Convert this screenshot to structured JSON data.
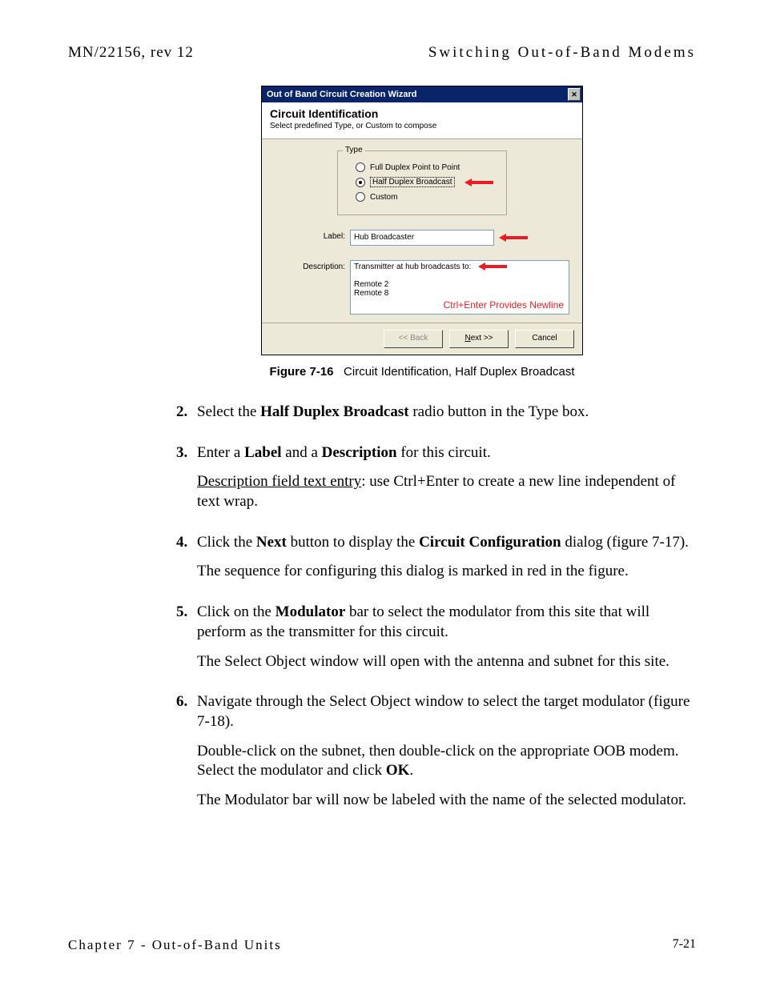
{
  "header": {
    "left": "MN/22156, rev 12",
    "right": "Switching Out-of-Band Modems"
  },
  "dialog": {
    "titlebar": "Out of Band Circuit Creation Wizard",
    "heading": "Circuit Identification",
    "subheading": "Select predefined Type, or Custom to compose",
    "type_legend": "Type",
    "radio_full": "Full Duplex Point to Point",
    "radio_half": "Half Duplex Broadcast",
    "radio_custom": "Custom",
    "label_label": "Label:",
    "label_value": "Hub Broadcaster",
    "desc_label": "Description:",
    "desc_line1": "Transmitter at hub broadcasts to:",
    "desc_line2": "Remote 2",
    "desc_line3": "Remote 8",
    "newline_note": "Ctrl+Enter Provides Newline",
    "btn_back": "<< Back",
    "btn_next_prefix": "N",
    "btn_next_rest": "ext >>",
    "btn_cancel": "Cancel"
  },
  "caption": {
    "fig": "Figure 7-16",
    "text": "Circuit Identification, Half Duplex Broadcast"
  },
  "steps": {
    "s2": {
      "num": "2.",
      "p1a": "Select the ",
      "p1b": "Half Duplex Broadcast",
      "p1c": " radio button in the Type box."
    },
    "s3": {
      "num": "3.",
      "p1a": "Enter a ",
      "p1b": "Label",
      "p1c": " and a ",
      "p1d": "Description",
      "p1e": " for this circuit.",
      "p2a": "Description field text entry",
      "p2b": ": use Ctrl+Enter to create a new line independent of text wrap."
    },
    "s4": {
      "num": "4.",
      "p1a": "Click the ",
      "p1b": "Next",
      "p1c": " button to display the ",
      "p1d": "Circuit Configuration",
      "p1e": " dialog (figure 7-17).",
      "p2": "The sequence for configuring this dialog is marked in red in the figure."
    },
    "s5": {
      "num": "5.",
      "p1a": "Click on the ",
      "p1b": "Modulator",
      "p1c": " bar to select the modulator from this site that will perform as the transmitter for this circuit.",
      "p2": "The Select Object window will open with the antenna and subnet for this site."
    },
    "s6": {
      "num": "6.",
      "p1": "Navigate through the Select Object window to select the target modulator (figure 7-18).",
      "p2a": "Double-click on the subnet, then double-click on the appropriate OOB modem. Select the modulator and click ",
      "p2b": "OK",
      "p2c": ".",
      "p3": "The Modulator bar will now be labeled with the name of the selected modulator."
    }
  },
  "footer": {
    "left": "Chapter 7 - Out-of-Band Units",
    "right": "7-21"
  }
}
